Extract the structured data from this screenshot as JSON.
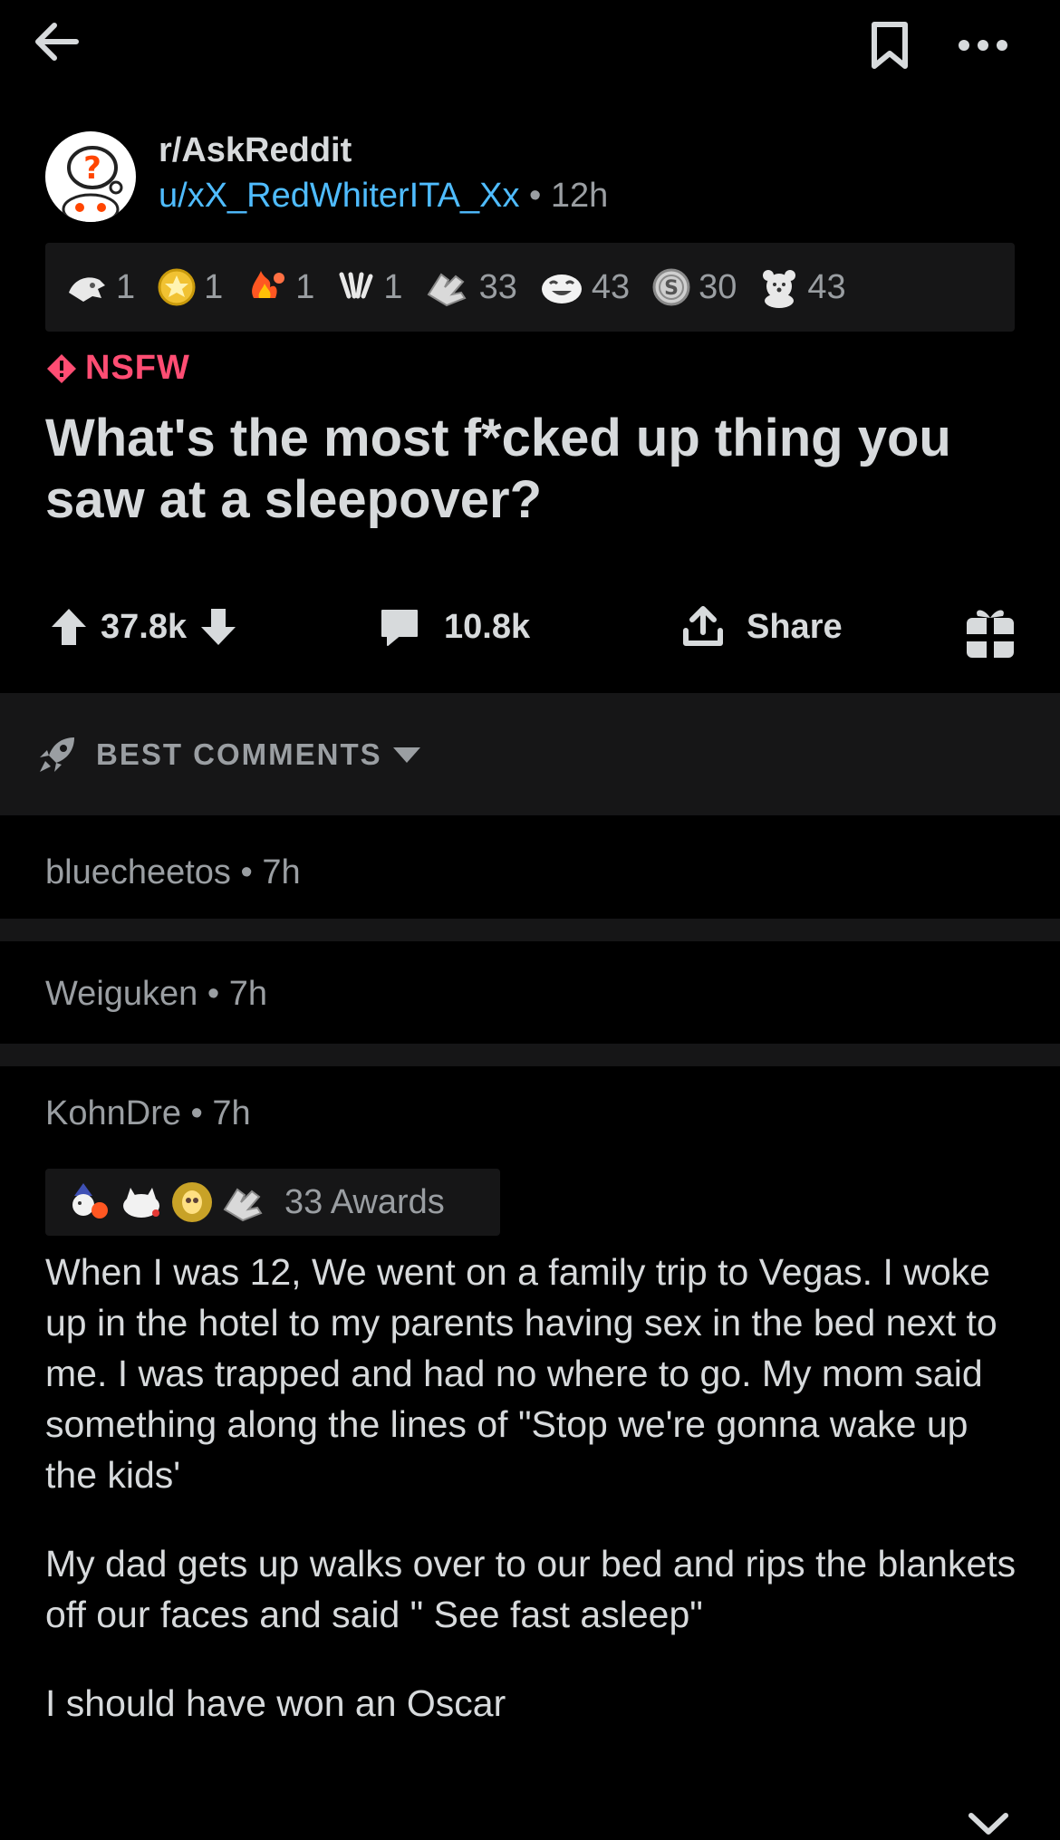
{
  "post": {
    "subreddit": "r/AskReddit",
    "author": "u/xX_RedWhiterITA_Xx",
    "time": "12h",
    "nsfw_label": "NSFW",
    "title": "What's the most f*cked up thing you saw at a sleepover?",
    "awards": [
      {
        "icon": "hand-award-icon",
        "count": "1"
      },
      {
        "icon": "gold-star-award-icon",
        "count": "1"
      },
      {
        "icon": "fire-award-icon",
        "count": "1"
      },
      {
        "icon": "rabbit-award-icon",
        "count": "1"
      },
      {
        "icon": "hands-award-icon",
        "count": "33"
      },
      {
        "icon": "laughing-award-icon",
        "count": "43"
      },
      {
        "icon": "silver-coin-award-icon",
        "count": "30"
      },
      {
        "icon": "bear-award-icon",
        "count": "43"
      }
    ],
    "upvotes": "37.8k",
    "comments": "10.8k",
    "share_label": "Share"
  },
  "sort": {
    "label": "BEST COMMENTS"
  },
  "collapsed_comments": [
    {
      "author": "bluecheetos",
      "time": "7h"
    },
    {
      "author": "Weiguken",
      "time": "7h"
    }
  ],
  "comment": {
    "author": "KohnDre",
    "time": "7h",
    "awards_label": "33 Awards",
    "award_icons": [
      "wizard-award-icon",
      "cat-award-icon",
      "golden-skull-award-icon",
      "hands-award-icon"
    ],
    "paragraphs": [
      "When I was 12, We went on a family trip to Vegas. I woke up in the hotel to my parents having sex in the bed next to me. I was trapped and had no where to go. My mom said something along the lines of \"Stop we're gonna wake up the kids'",
      "My dad gets up walks over to our bed and rips the blankets off our faces and said \" See fast asleep\"",
      "I should have won an Oscar"
    ]
  },
  "colors": {
    "background": "#000000",
    "surface": "#161617",
    "text": "#d7dadc",
    "muted": "#9a9ea2",
    "link": "#4fbcff",
    "nsfw": "#ff4d73"
  }
}
